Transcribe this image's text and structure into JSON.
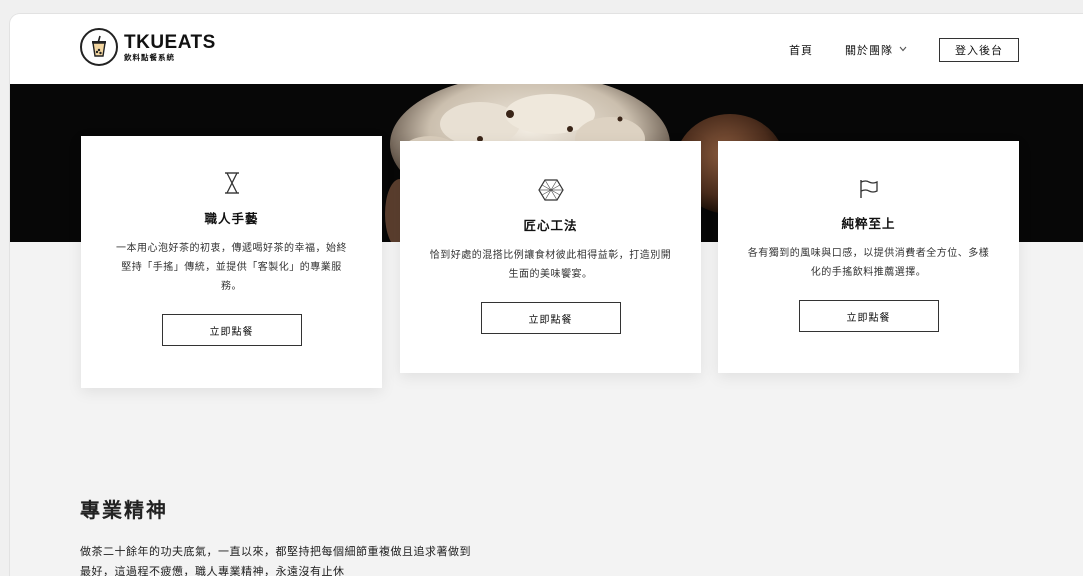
{
  "brand": {
    "title": "TKUEATS",
    "subtitle": "飲料點餐系統",
    "badge_top": "BUBBLE",
    "badge_bottom": "BOBA",
    "icon": "bubble-tea-cup-icon"
  },
  "nav": {
    "home": "首頁",
    "about": "關於團隊",
    "about_icon": "chevron-down-icon",
    "login": "登入後台"
  },
  "cards": [
    {
      "icon": "hourglass-icon",
      "title": "職人手藝",
      "desc": "一本用心泡好茶的初衷，傳遞喝好茶的幸福，始終堅持「手搖」傳統，並提供「客製化」的專業服務。",
      "button": "立即點餐"
    },
    {
      "icon": "diamond-icon",
      "title": "匠心工法",
      "desc": "恰到好處的混搭比例讓食材彼此相得益彰，打造別開生面的美味饗宴。",
      "button": "立即點餐"
    },
    {
      "icon": "flag-icon",
      "title": "純粹至上",
      "desc": "各有獨到的風味與口感，以提供消費者全方位、多樣化的手搖飲料推薦選擇。",
      "button": "立即點餐"
    }
  ],
  "section": {
    "title": "專業精神",
    "text": "做茶二十餘年的功夫底氣，一直以來，都堅持把每個細節重複做且追求著做到最好，這過程不疲憊，職人專業精神，永遠沒有止休"
  },
  "colors": {
    "hero_bg": "#070707",
    "page_bg": "#f3f3f3",
    "card_bg": "#ffffff",
    "text": "#222222"
  }
}
